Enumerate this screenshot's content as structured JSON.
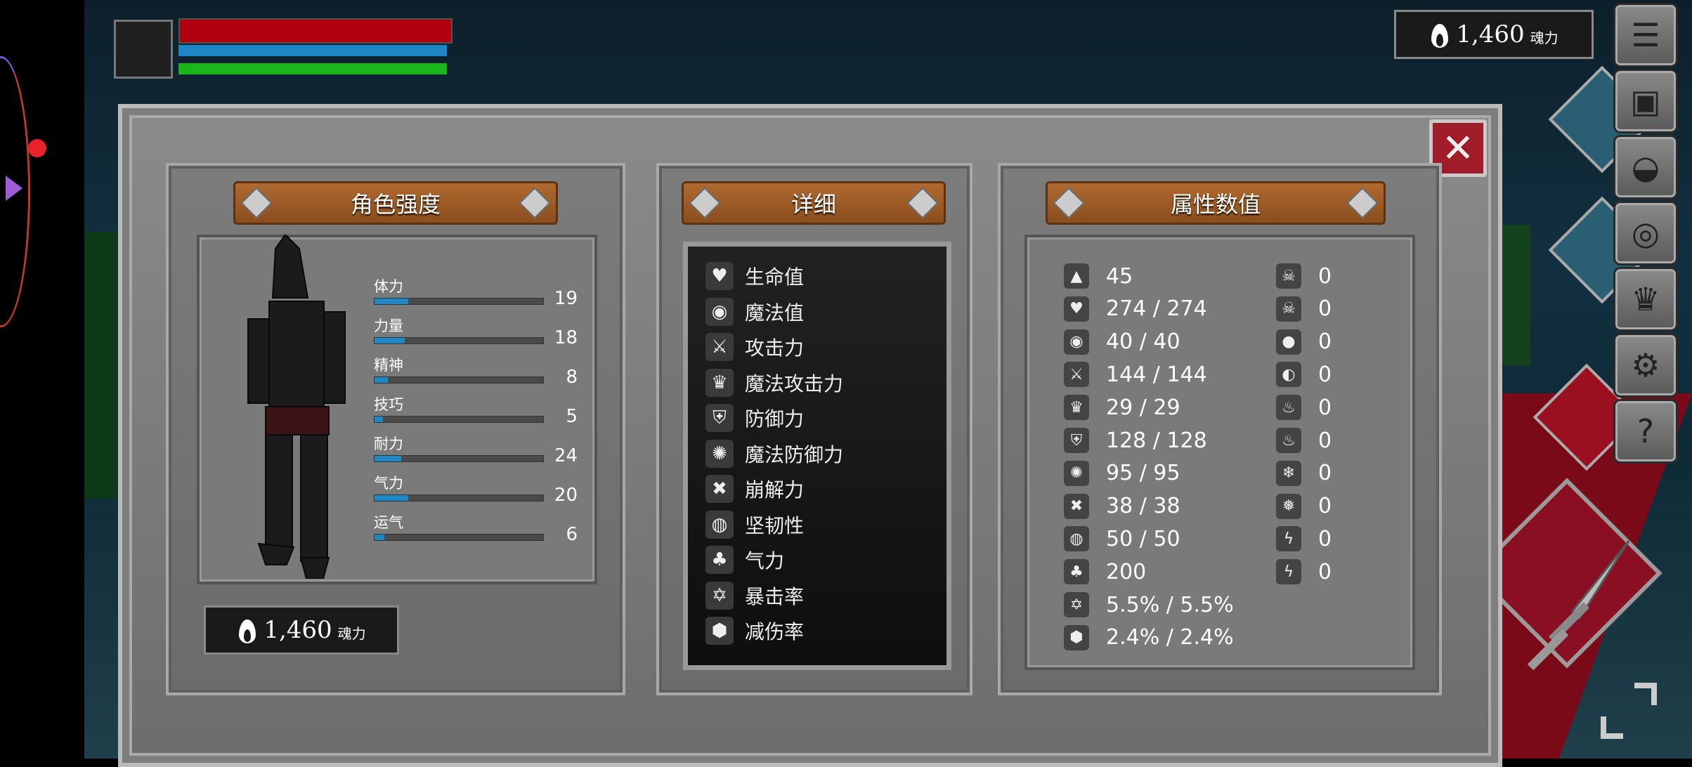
{
  "hud": {
    "currency_value": "1,460",
    "currency_unit": "魂力"
  },
  "panel": {
    "left_title": "角色强度",
    "middle_title": "详细",
    "right_title": "属性数值",
    "close_label": "✕",
    "currency_value": "1,460",
    "currency_unit": "魂力"
  },
  "stats": [
    {
      "label": "体力",
      "value": "19",
      "fill_fraction": 0.2
    },
    {
      "label": "力量",
      "value": "18",
      "fill_fraction": 0.18
    },
    {
      "label": "精神",
      "value": "8",
      "fill_fraction": 0.08
    },
    {
      "label": "技巧",
      "value": "5",
      "fill_fraction": 0.05
    },
    {
      "label": "耐力",
      "value": "24",
      "fill_fraction": 0.16
    },
    {
      "label": "气力",
      "value": "20",
      "fill_fraction": 0.2
    },
    {
      "label": "运气",
      "value": "6",
      "fill_fraction": 0.06
    }
  ],
  "details": [
    {
      "label": "生命值",
      "icon": "heart-icon",
      "glyph": "♥"
    },
    {
      "label": "魔法值",
      "icon": "brain-icon",
      "glyph": "◉"
    },
    {
      "label": "攻击力",
      "icon": "sword-icon",
      "glyph": "⚔"
    },
    {
      "label": "魔法攻击力",
      "icon": "magic-attack-icon",
      "glyph": "♛"
    },
    {
      "label": "防御力",
      "icon": "shield-icon",
      "glyph": "⛨"
    },
    {
      "label": "魔法防御力",
      "icon": "magic-shield-icon",
      "glyph": "✺"
    },
    {
      "label": "崩解力",
      "icon": "hammer-icon",
      "glyph": "✖"
    },
    {
      "label": "坚韧性",
      "icon": "helmet-icon",
      "glyph": "◍"
    },
    {
      "label": "气力",
      "icon": "lungs-icon",
      "glyph": "♣"
    },
    {
      "label": "暴击率",
      "icon": "critical-icon",
      "glyph": "✡"
    },
    {
      "label": "减伤率",
      "icon": "damage-reduction-icon",
      "glyph": "⬢"
    }
  ],
  "attributes_left": [
    {
      "value": "45",
      "icon": "level-icon",
      "glyph": "▲"
    },
    {
      "value": "274 / 274",
      "icon": "heart-icon",
      "glyph": "♥"
    },
    {
      "value": "40 / 40",
      "icon": "brain-icon",
      "glyph": "◉"
    },
    {
      "value": "144 / 144",
      "icon": "sword-icon",
      "glyph": "⚔"
    },
    {
      "value": "29 / 29",
      "icon": "magic-attack-icon",
      "glyph": "♛"
    },
    {
      "value": "128 / 128",
      "icon": "shield-icon",
      "glyph": "⛨"
    },
    {
      "value": "95 / 95",
      "icon": "magic-shield-icon",
      "glyph": "✺"
    },
    {
      "value": "38 / 38",
      "icon": "hammer-icon",
      "glyph": "✖"
    },
    {
      "value": "50 / 50",
      "icon": "helmet-icon",
      "glyph": "◍"
    },
    {
      "value": "200",
      "icon": "lungs-icon",
      "glyph": "♣"
    },
    {
      "value": "5.5% / 5.5%",
      "icon": "critical-icon",
      "glyph": "✡"
    },
    {
      "value": "2.4% / 2.4%",
      "icon": "damage-reduction-icon",
      "glyph": "⬢"
    }
  ],
  "attributes_right": [
    {
      "value": "0",
      "icon": "poison-icon",
      "glyph": "☠"
    },
    {
      "value": "0",
      "icon": "poison-resist-icon",
      "glyph": "☠"
    },
    {
      "value": "0",
      "icon": "bleed-icon",
      "glyph": "●"
    },
    {
      "value": "0",
      "icon": "bleed-resist-icon",
      "glyph": "◐"
    },
    {
      "value": "0",
      "icon": "fire-icon",
      "glyph": "♨"
    },
    {
      "value": "0",
      "icon": "fire-resist-icon",
      "glyph": "♨"
    },
    {
      "value": "0",
      "icon": "frost-icon",
      "glyph": "❄"
    },
    {
      "value": "0",
      "icon": "frost-resist-icon",
      "glyph": "❅"
    },
    {
      "value": "0",
      "icon": "lightning-icon",
      "glyph": "ϟ"
    },
    {
      "value": "0",
      "icon": "lightning-resist-icon",
      "glyph": "ϟ"
    }
  ],
  "side_menu": [
    {
      "icon": "menu-list-icon",
      "glyph": "☰"
    },
    {
      "icon": "backpack-icon",
      "glyph": "▣"
    },
    {
      "icon": "helmet-equip-icon",
      "glyph": "◒"
    },
    {
      "icon": "emblem-icon",
      "glyph": "◎"
    },
    {
      "icon": "crown-icon",
      "glyph": "♛"
    },
    {
      "icon": "settings-gear-icon",
      "glyph": "⚙"
    },
    {
      "icon": "help-icon",
      "glyph": "?"
    }
  ]
}
